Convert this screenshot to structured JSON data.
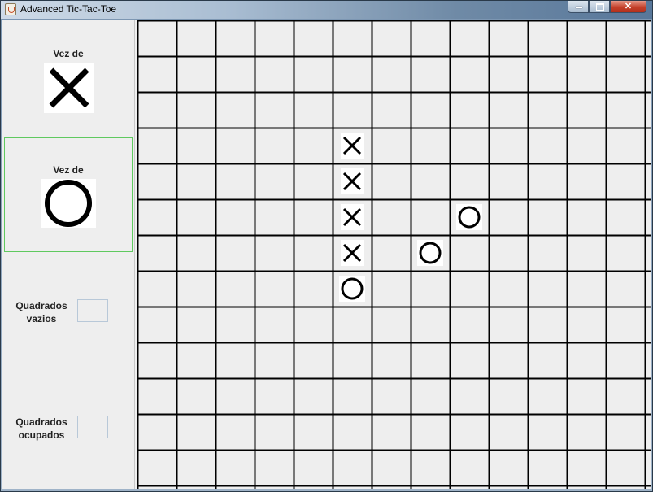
{
  "window": {
    "title": "Advanced Tic-Tac-Toe",
    "minimize_symbol": "",
    "maximize_symbol": "",
    "close_symbol": "✕"
  },
  "sidebar": {
    "turn_x": {
      "label": "Vez de",
      "piece": "X"
    },
    "turn_o": {
      "label": "Vez de",
      "piece": "O",
      "active": true,
      "highlight_color": "#5fc95f"
    },
    "empty_squares": {
      "label_line1": "Quadrados",
      "label_line2": "vazios",
      "value": ""
    },
    "occupied_squares": {
      "label_line1": "Quadrados",
      "label_line2": "ocupados",
      "value": ""
    }
  },
  "board": {
    "columns": 13,
    "rows": 13,
    "cells": [
      {
        "row": 3,
        "col": 5,
        "mark": "X"
      },
      {
        "row": 4,
        "col": 5,
        "mark": "X"
      },
      {
        "row": 5,
        "col": 5,
        "mark": "X"
      },
      {
        "row": 6,
        "col": 5,
        "mark": "X"
      },
      {
        "row": 7,
        "col": 5,
        "mark": "O"
      },
      {
        "row": 6,
        "col": 7,
        "mark": "O"
      },
      {
        "row": 5,
        "col": 8,
        "mark": "O"
      }
    ]
  }
}
